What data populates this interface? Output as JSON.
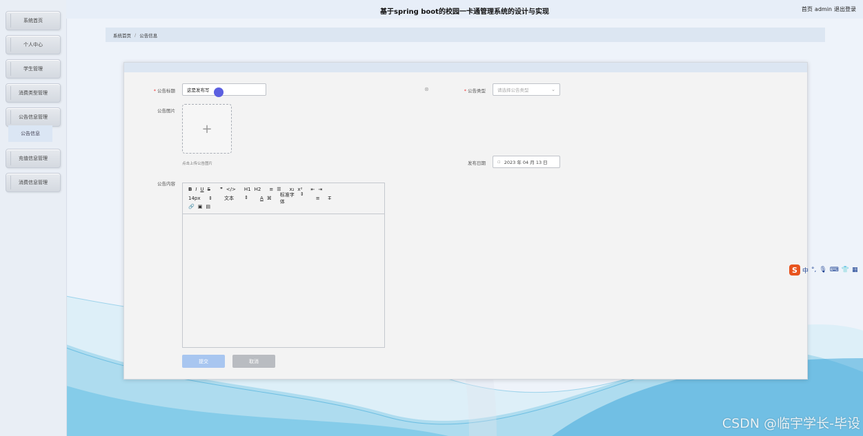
{
  "header": {
    "title": "基于spring boot的校园一卡通管理系统的设计与实现",
    "home_link": "首页",
    "username": "admin",
    "logout_link": "退出登录"
  },
  "sidebar": {
    "items": [
      {
        "label": "系统首页"
      },
      {
        "label": "个人中心"
      },
      {
        "label": "学生管理"
      },
      {
        "label": "消费类型管理"
      },
      {
        "label": "公告信息管理"
      },
      {
        "label": "充值信息管理"
      },
      {
        "label": "消费信息管理"
      }
    ],
    "submenu_item": "公告信息"
  },
  "breadcrumb": {
    "home": "系统首页",
    "separator": "/",
    "current": "公告信息"
  },
  "form": {
    "title_label": "公告标题",
    "title_value": "这是发布写",
    "type_label": "公告类型",
    "type_placeholder": "请选择公告类型",
    "image_label": "公告图片",
    "upload_plus": "+",
    "upload_tip": "点击上传公告图片",
    "date_label": "发布日期",
    "date_value": "2023 年 04 月 13 日",
    "content_label": "公告内容",
    "submit_label": "提交",
    "cancel_label": "取消"
  },
  "editor_toolbar": {
    "row1": [
      "B",
      "I",
      "U",
      "S",
      "❞",
      "</>",
      "H1",
      "H2",
      "≡",
      "☰",
      "x₂",
      "x²",
      "⇤",
      "⇥"
    ],
    "font_size": "14px",
    "text_style": "文本",
    "font_family": "标准字体",
    "row3": [
      "🔗",
      "▣",
      "▤"
    ]
  },
  "ime": {
    "logo": "S",
    "mode": "中"
  },
  "watermark": "CSDN @临宇学长-毕设",
  "colors": {
    "accent": "#a8c6f0",
    "header_bg": "#e7eef8",
    "breadcrumb_bg": "#dce6f2",
    "required": "#e33333",
    "cursor": "#5b5fe0"
  }
}
